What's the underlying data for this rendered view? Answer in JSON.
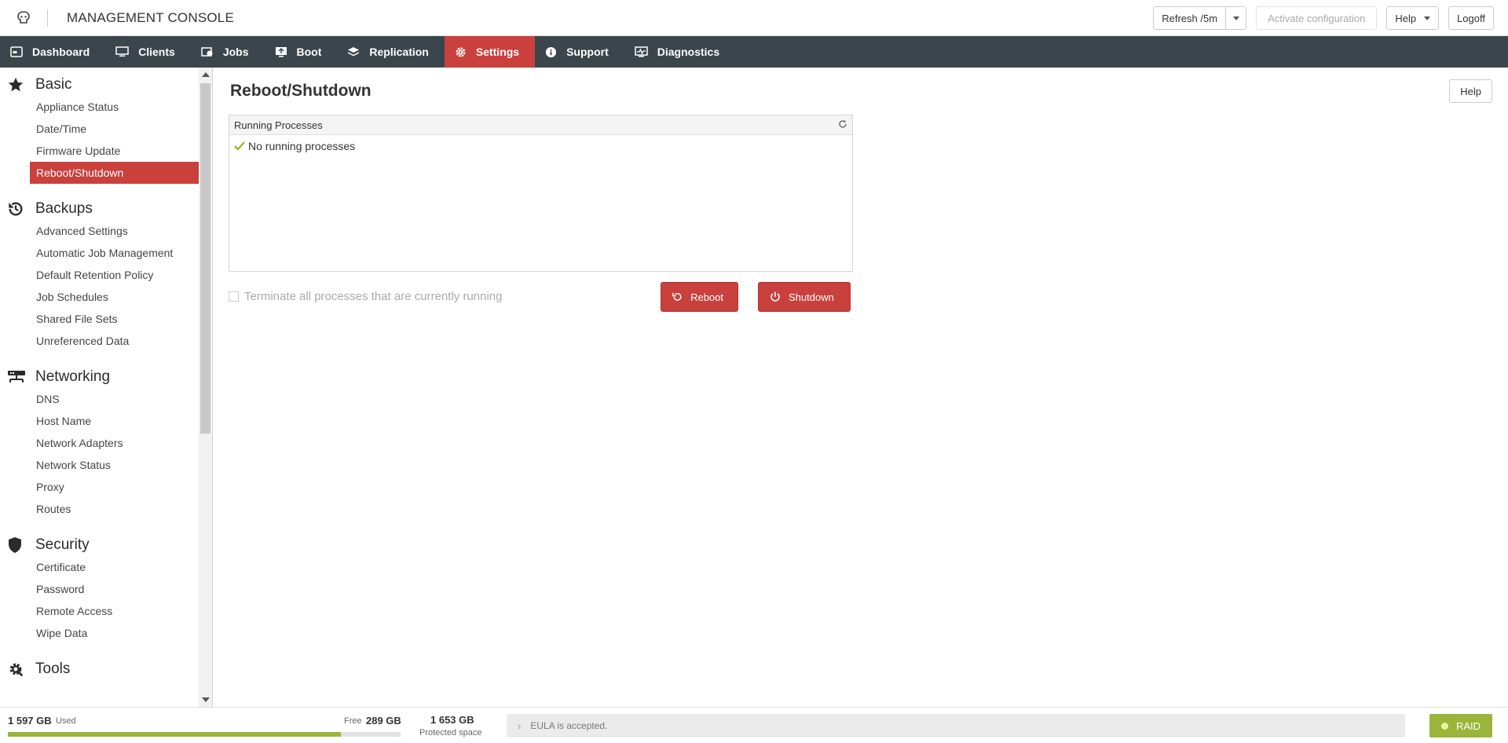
{
  "header": {
    "app_title": "MANAGEMENT CONSOLE",
    "refresh_label": "Refresh /5m",
    "activate_label": "Activate configuration",
    "help_label": "Help",
    "logoff_label": "Logoff"
  },
  "nav": {
    "items": [
      {
        "label": "Dashboard",
        "icon": "dashboard-icon"
      },
      {
        "label": "Clients",
        "icon": "monitor-icon"
      },
      {
        "label": "Jobs",
        "icon": "jobs-icon"
      },
      {
        "label": "Boot",
        "icon": "boot-icon"
      },
      {
        "label": "Replication",
        "icon": "replication-icon"
      },
      {
        "label": "Settings",
        "icon": "gear-icon",
        "active": true
      },
      {
        "label": "Support",
        "icon": "info-icon"
      },
      {
        "label": "Diagnostics",
        "icon": "diagnostics-icon"
      }
    ]
  },
  "sidebar": {
    "sections": [
      {
        "title": "Basic",
        "icon": "star-icon",
        "items": [
          "Appliance Status",
          "Date/Time",
          "Firmware Update",
          "Reboot/Shutdown"
        ]
      },
      {
        "title": "Backups",
        "icon": "history-icon",
        "items": [
          "Advanced Settings",
          "Automatic Job Management",
          "Default Retention Policy",
          "Job Schedules",
          "Shared File Sets",
          "Unreferenced Data"
        ]
      },
      {
        "title": "Networking",
        "icon": "network-icon",
        "items": [
          "DNS",
          "Host Name",
          "Network Adapters",
          "Network Status",
          "Proxy",
          "Routes"
        ]
      },
      {
        "title": "Security",
        "icon": "shield-icon",
        "items": [
          "Certificate",
          "Password",
          "Remote Access",
          "Wipe Data"
        ]
      },
      {
        "title": "Tools",
        "icon": "tools-icon",
        "items": []
      }
    ],
    "active_item": "Reboot/Shutdown"
  },
  "main": {
    "title": "Reboot/Shutdown",
    "help_label": "Help",
    "panel_title": "Running Processes",
    "panel_message": "No running processes",
    "terminate_label": "Terminate all processes that are currently running",
    "reboot_label": "Reboot",
    "shutdown_label": "Shutdown"
  },
  "footer": {
    "used_value": "1 597 GB",
    "used_label": "Used",
    "free_label": "Free",
    "free_value": "289 GB",
    "usage_fraction": 0.847,
    "protected_value": "1 653 GB",
    "protected_label": "Protected space",
    "eula_text": "EULA is accepted.",
    "raid_label": "RAID"
  },
  "colors": {
    "accent": "#c9403d",
    "nav_bg": "#3b464c",
    "ok_green": "#9bb53a"
  }
}
